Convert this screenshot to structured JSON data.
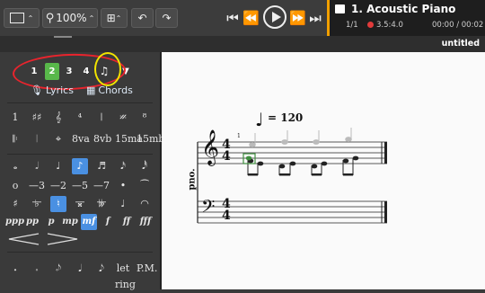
{
  "toolbar": {
    "zoom_value": "100%",
    "buttons": [
      "view-mode",
      "zoom",
      "layout",
      "undo",
      "redo"
    ]
  },
  "transport": {
    "track_title": "1. Acoustic Piano",
    "page_index": "1/1",
    "position": "3.5:4.0",
    "time": "00:00 / 00:02"
  },
  "document": {
    "title": "untitled"
  },
  "palette": {
    "voices": [
      "1",
      "2",
      "3",
      "4"
    ],
    "active_voice": "2",
    "lyrics_label": "Lyrics",
    "chords_label": "Chords",
    "row_fingering": [
      "1",
      "♯♯",
      "𝄞",
      "⁴",
      "𝄁",
      "𝄏",
      "⁸"
    ],
    "row_ottava": [
      "𝄆",
      "𝄀",
      "⌖",
      "8va",
      "8vb",
      "15ma",
      "15mb"
    ],
    "durations": [
      "𝅝",
      "𝅗𝅥",
      "♩",
      "♪",
      "♬",
      "𝅘𝅥𝅯",
      "𝅘𝅥𝅰"
    ],
    "tuplets": [
      "ᴏ",
      "—3—",
      "—2—",
      "—5—",
      "—7—",
      "•",
      "⁀"
    ],
    "accidentals": [
      "♯",
      "♭",
      "♮",
      "𝄪",
      "𝄫",
      "♩",
      "◠"
    ],
    "dynamics": [
      "ppp",
      "pp",
      "p",
      "mp",
      "mf",
      "f",
      "ff",
      "fff"
    ],
    "active_dynamic": "mf",
    "ornaments": [
      "𝆺",
      "𝆹",
      "𝆹𝅥𝅮",
      "𝅘𝅥",
      "𝅘𝅥𝅮",
      "let ring",
      "P.M."
    ]
  },
  "score": {
    "tempo": "= 120",
    "instrument": "pno.",
    "time_sig_top": "4",
    "time_sig_bottom": "4",
    "measure_number": "1"
  },
  "colors": {
    "accent_orange": "#f2a000",
    "selection_blue": "#4a90e2",
    "voice_green": "#58b84a",
    "annot_red": "#e8242d",
    "annot_yellow": "#f2e400"
  }
}
